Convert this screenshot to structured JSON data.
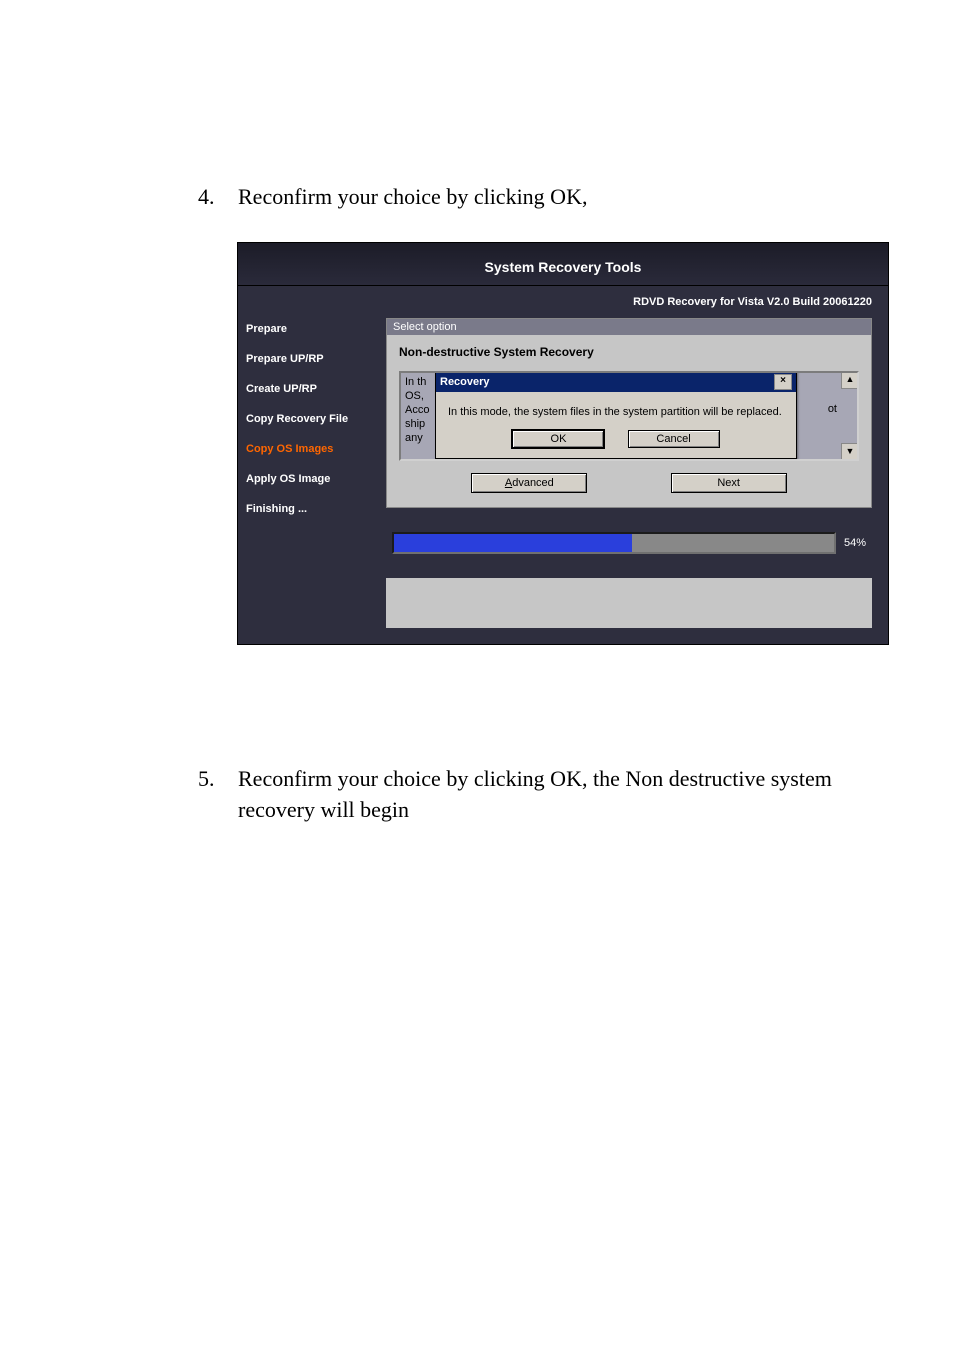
{
  "steps": {
    "s4_num": "4.",
    "s4_text": "Reconfirm your choice by clicking OK,",
    "s5_num": "5.",
    "s5_text": "Reconfirm your choice by clicking OK, the Non destructive system recovery will begin"
  },
  "app": {
    "title": "System Recovery Tools",
    "version": "RDVD Recovery for Vista V2.0 Build 20061220"
  },
  "sidebar": {
    "items": [
      {
        "label": "Prepare"
      },
      {
        "label": "Prepare UP/RP"
      },
      {
        "label": "Create UP/RP"
      },
      {
        "label": "Copy Recovery File"
      },
      {
        "label": "Copy OS Images"
      },
      {
        "label": "Apply OS Image"
      },
      {
        "label": "Finishing ..."
      }
    ],
    "active_index": 4
  },
  "select_panel": {
    "header": "Select option",
    "title": "Non-destructive System Recovery",
    "list_fragments": [
      "In th",
      "OS, ",
      "Acco",
      "ship",
      "any"
    ],
    "list_right_fragment": "ot",
    "advanced_btn": "Advanced",
    "next_btn": "Next"
  },
  "modal": {
    "title": "Recovery",
    "message": "In this mode, the system files in the system partition will be replaced.",
    "ok": "OK",
    "cancel": "Cancel",
    "close": "×"
  },
  "progress": {
    "percent": 54,
    "label": "54%"
  }
}
